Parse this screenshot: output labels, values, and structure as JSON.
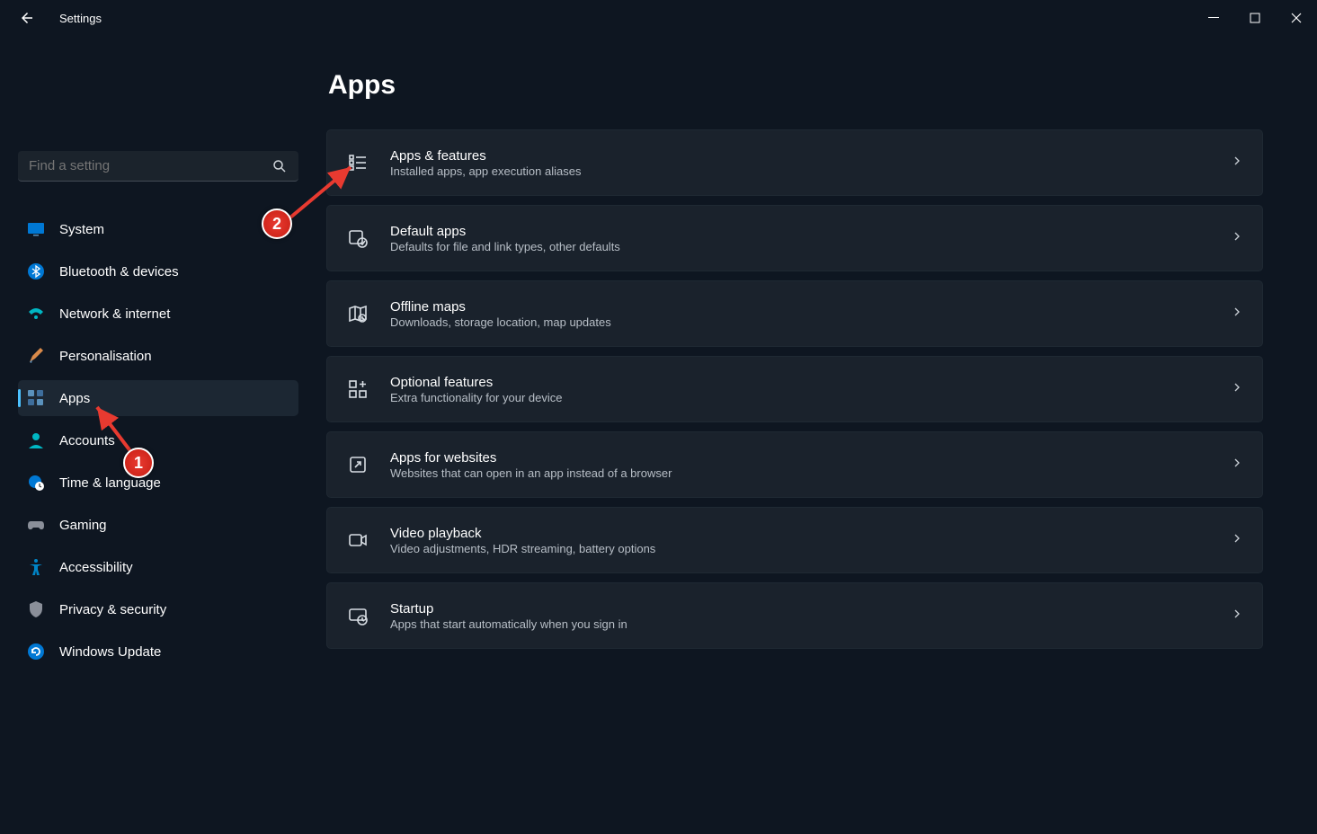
{
  "window": {
    "title": "Settings"
  },
  "search": {
    "placeholder": "Find a setting"
  },
  "sidebar": {
    "items": [
      {
        "label": "System"
      },
      {
        "label": "Bluetooth & devices"
      },
      {
        "label": "Network & internet"
      },
      {
        "label": "Personalisation"
      },
      {
        "label": "Apps"
      },
      {
        "label": "Accounts"
      },
      {
        "label": "Time & language"
      },
      {
        "label": "Gaming"
      },
      {
        "label": "Accessibility"
      },
      {
        "label": "Privacy & security"
      },
      {
        "label": "Windows Update"
      }
    ]
  },
  "page": {
    "title": "Apps",
    "items": [
      {
        "title": "Apps & features",
        "desc": "Installed apps, app execution aliases"
      },
      {
        "title": "Default apps",
        "desc": "Defaults for file and link types, other defaults"
      },
      {
        "title": "Offline maps",
        "desc": "Downloads, storage location, map updates"
      },
      {
        "title": "Optional features",
        "desc": "Extra functionality for your device"
      },
      {
        "title": "Apps for websites",
        "desc": "Websites that can open in an app instead of a browser"
      },
      {
        "title": "Video playback",
        "desc": "Video adjustments, HDR streaming, battery options"
      },
      {
        "title": "Startup",
        "desc": "Apps that start automatically when you sign in"
      }
    ]
  },
  "annotations": [
    {
      "label": "1"
    },
    {
      "label": "2"
    }
  ]
}
